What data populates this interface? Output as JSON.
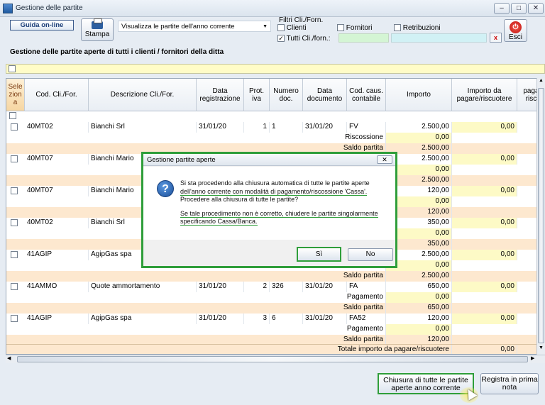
{
  "window": {
    "title": "Gestione delle partite",
    "btn_min": "–",
    "btn_max": "□",
    "btn_close": "✕"
  },
  "toolbar": {
    "guida": "Guida on-line",
    "stampa": "Stampa",
    "visualizza": "Visualizza le partite dell'anno corrente",
    "filtri_label": "Filtri Cli./Forn.",
    "clienti": "Clienti",
    "fornitori": "Fornitori",
    "retribuzioni": "Retribuzioni",
    "tutti": "Tutti Cli./forn.:",
    "esci": "Esci",
    "x_label": "x"
  },
  "page_title": "Gestione delle partite aperte di tutti i clienti / fornitori della ditta",
  "columns": [
    "Sele zion a",
    "Cod. Cli./For.",
    "Descrizione Cli./For.",
    "Data registrazione",
    "Prot. iva",
    "Numero doc.",
    "Data documento",
    "Cod. caus. contabile",
    "Importo",
    "Importo da pagare/riscuotere",
    "paga risc"
  ],
  "rows": [
    {
      "type": "main",
      "code": "40MT02",
      "desc": "Bianchi Srl",
      "date": "31/01/20",
      "prot": "1",
      "num": "1",
      "datadoc": "31/01/20",
      "caus": "FV",
      "importo": "2.500,00",
      "pagare": "0,00"
    },
    {
      "type": "sub",
      "label": "Riscossione",
      "importo": "0,00"
    },
    {
      "type": "saldo",
      "label": "Saldo partita",
      "importo": "2.500,00"
    },
    {
      "type": "main",
      "code": "40MT07",
      "desc": "Bianchi Mario",
      "date": "",
      "prot": "",
      "num": "",
      "datadoc": "",
      "caus": "",
      "importo": "2.500,00",
      "pagare": "0,00"
    },
    {
      "type": "sub",
      "label": "",
      "importo": "0,00"
    },
    {
      "type": "saldo",
      "label": "",
      "importo": "2.500,00"
    },
    {
      "type": "main",
      "code": "40MT07",
      "desc": "Bianchi Mario",
      "date": "",
      "prot": "",
      "num": "",
      "datadoc": "",
      "caus": "",
      "importo": "120,00",
      "pagare": "0,00"
    },
    {
      "type": "sub",
      "label": "",
      "importo": "0,00"
    },
    {
      "type": "saldo",
      "label": "",
      "importo": "120,00"
    },
    {
      "type": "main",
      "code": "40MT02",
      "desc": "Bianchi Srl",
      "date": "",
      "prot": "",
      "num": "",
      "datadoc": "",
      "caus": "",
      "importo": "350,00",
      "pagare": "0,00"
    },
    {
      "type": "sub",
      "label": "",
      "importo": "0,00"
    },
    {
      "type": "saldo",
      "label": "",
      "importo": "350,00"
    },
    {
      "type": "main",
      "code": "41AGIP",
      "desc": "AgipGas spa",
      "date": "",
      "prot": "",
      "num": "",
      "datadoc": "",
      "caus": "",
      "importo": "2.500,00",
      "pagare": "0,00"
    },
    {
      "type": "sub",
      "label": "",
      "importo": "0,00"
    },
    {
      "type": "saldo",
      "label": "Saldo partita",
      "importo": "2.500,00"
    },
    {
      "type": "main",
      "code": "41AMMO",
      "desc": "Quote ammortamento",
      "date": "31/01/20",
      "prot": "2",
      "num": "326",
      "datadoc": "31/01/20",
      "caus": "FA",
      "importo": "650,00",
      "pagare": "0,00"
    },
    {
      "type": "sub",
      "label": "Pagamento",
      "importo": "0,00"
    },
    {
      "type": "saldo",
      "label": "Saldo partita",
      "importo": "650,00"
    },
    {
      "type": "main",
      "code": "41AGIP",
      "desc": "AgipGas spa",
      "date": "31/01/20",
      "prot": "3",
      "num": "6",
      "datadoc": "31/01/20",
      "caus": "FA52",
      "importo": "120,00",
      "pagare": "0,00"
    },
    {
      "type": "sub",
      "label": "Pagamento",
      "importo": "0,00"
    },
    {
      "type": "saldo",
      "label": "Saldo partita",
      "importo": "120,00"
    }
  ],
  "total": {
    "label": "Totale importo da pagare/riscuotere",
    "value": "0,00"
  },
  "buttons": {
    "chiusura": "Chiusura di tutte le partite aperte anno corrente",
    "registra": "Registra in prima nota"
  },
  "dialog": {
    "title": "Gestione partite aperte",
    "line1": "Si sta procedendo alla chiusura automatica di tutte le partite aperte",
    "line2": "dell'anno corrente con modalità di pagamento/riscossione 'Cassa'.",
    "line3": "Procedere alla chiusura di tutte le partite?",
    "line4": "Se tale procedimento non è corretto, chiudere le partite singolarmente",
    "line5": "specificando Cassa/Banca.",
    "yes": "Sì",
    "no": "No",
    "close": "✕"
  },
  "colors": {
    "accent_green": "#2f9e3a",
    "yellow_row": "#fdfac6",
    "saldo_row": "#fde8cf"
  }
}
